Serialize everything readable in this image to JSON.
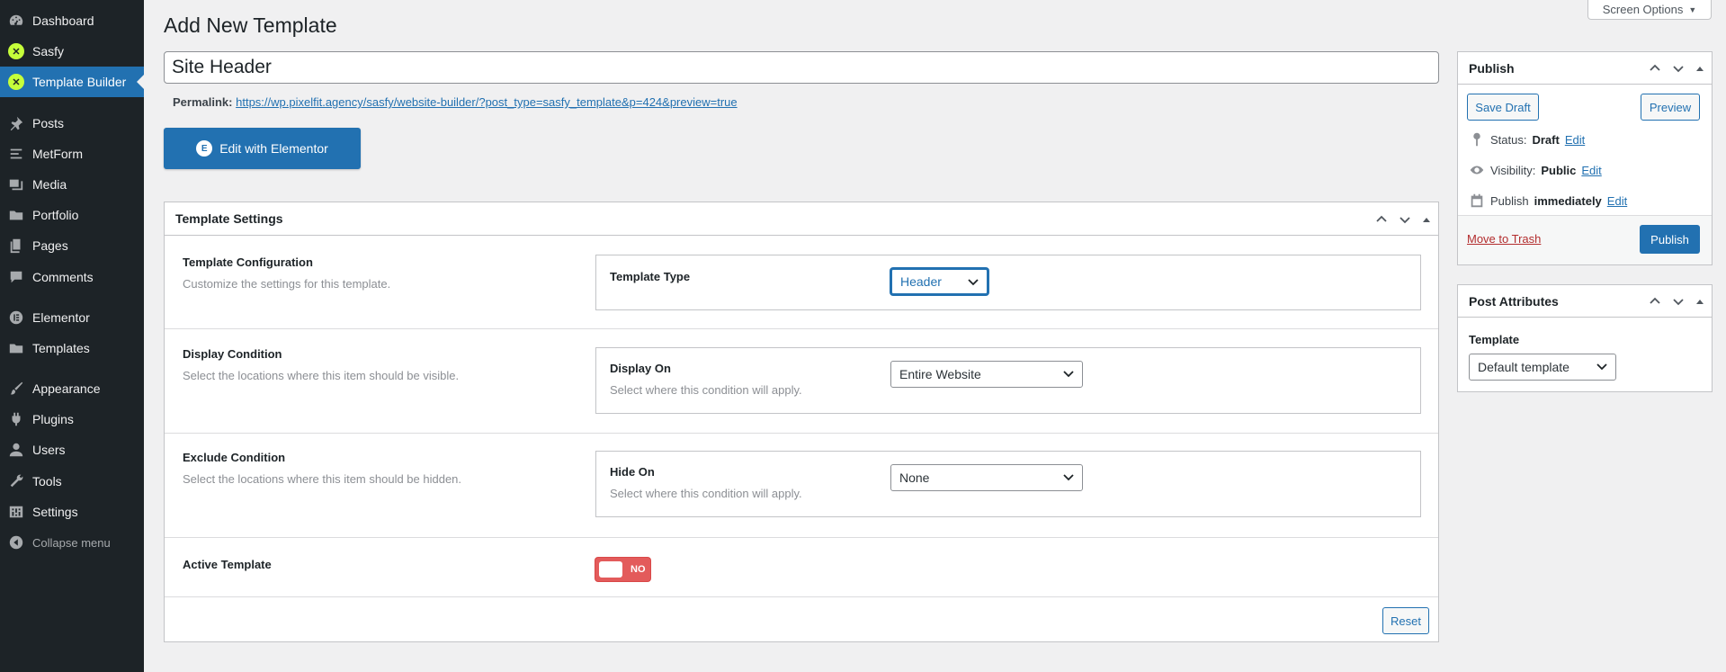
{
  "sidebar": {
    "items": [
      {
        "label": "Dashboard",
        "icon": "dashboard-icon"
      },
      {
        "label": "Sasfy",
        "icon": "sasfy-icon"
      },
      {
        "label": "Template Builder",
        "icon": "sasfy-icon"
      },
      {
        "label": "Posts",
        "icon": "pin-icon"
      },
      {
        "label": "MetForm",
        "icon": "form-icon"
      },
      {
        "label": "Media",
        "icon": "media-icon"
      },
      {
        "label": "Portfolio",
        "icon": "folder-icon"
      },
      {
        "label": "Pages",
        "icon": "pages-icon"
      },
      {
        "label": "Comments",
        "icon": "comment-icon"
      },
      {
        "label": "Elementor",
        "icon": "elementor-icon"
      },
      {
        "label": "Templates",
        "icon": "folder-icon"
      },
      {
        "label": "Appearance",
        "icon": "brush-icon"
      },
      {
        "label": "Plugins",
        "icon": "plugin-icon"
      },
      {
        "label": "Users",
        "icon": "user-icon"
      },
      {
        "label": "Tools",
        "icon": "wrench-icon"
      },
      {
        "label": "Settings",
        "icon": "settings-icon"
      },
      {
        "label": "Collapse menu",
        "icon": "collapse-icon"
      }
    ],
    "sasfy_glyph": "✕",
    "elementor_glyph": "E"
  },
  "header": {
    "title": "Add New Template",
    "screen_options": "Screen Options",
    "screen_options_arrow": "▼"
  },
  "post": {
    "title_value": "Site Header",
    "permalink_label": "Permalink:",
    "permalink_url": "https://wp.pixelfit.agency/sasfy/website-builder/?post_type=sasfy_template&p=424&preview=true",
    "edit_elementor": "Edit with Elementor"
  },
  "template_settings": {
    "title": "Template Settings",
    "config": {
      "label": "Template Configuration",
      "desc": "Customize the settings for this template.",
      "field_label": "Template Type",
      "select_value": "Header"
    },
    "display": {
      "label": "Display Condition",
      "desc": "Select the locations where this item should be visible.",
      "field_label": "Display On",
      "field_desc": "Select where this condition will apply.",
      "select_value": "Entire Website"
    },
    "exclude": {
      "label": "Exclude Condition",
      "desc": "Select the locations where this item should be hidden.",
      "field_label": "Hide On",
      "field_desc": "Select where this condition will apply.",
      "select_value": "None"
    },
    "active": {
      "label": "Active Template",
      "toggle_text": "NO"
    },
    "reset": "Reset"
  },
  "publish": {
    "title": "Publish",
    "save_draft": "Save Draft",
    "preview": "Preview",
    "status_label": "Status:",
    "status_value": "Draft",
    "visibility_label": "Visibility:",
    "visibility_value": "Public",
    "publish_label": "Publish",
    "publish_value": "immediately",
    "edit": "Edit",
    "trash": "Move to Trash",
    "publish_button": "Publish"
  },
  "attributes": {
    "title": "Post Attributes",
    "template_label": "Template",
    "template_value": "Default template"
  },
  "colors": {
    "sidebar_bg": "#1d2327",
    "accent": "#2271b1",
    "toggle_off": "#e35b5b",
    "sasfy_green": "#c6ff3a"
  }
}
